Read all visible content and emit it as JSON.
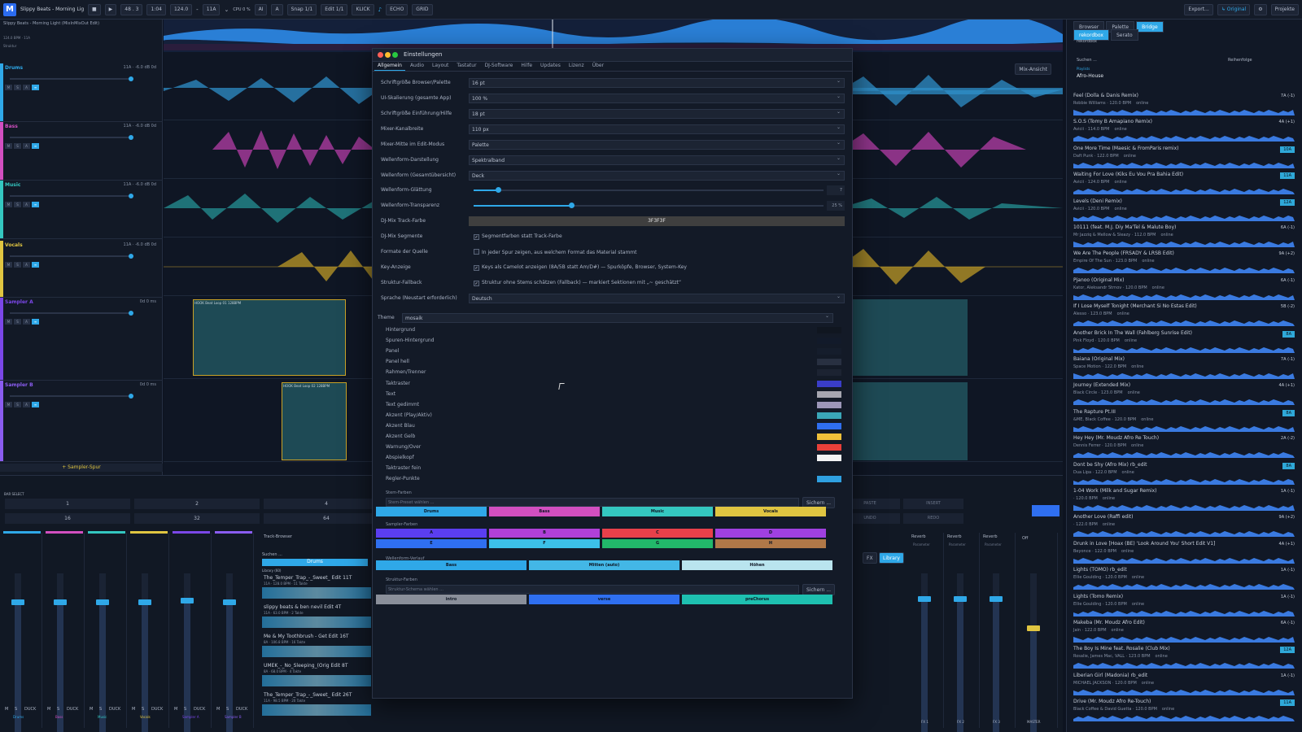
{
  "topbar": {
    "app_initial": "M",
    "title": "Slippy Beats - Morning Light",
    "bars": "48 . 3",
    "time": "1:04",
    "bpm": "124.0",
    "minus": "-",
    "key": "11A",
    "cpu": "CPU 0 %",
    "a_label": "A̲",
    "snap": "Snap 1/1",
    "edit": "Edit 1/1",
    "click": "KLICK",
    "echo": "ECHO",
    "grid": "GRID",
    "export": "Export...",
    "original": "↳ Original",
    "projects": "Projekte"
  },
  "tracks_panel": {
    "project_line": "Slippy Beats - Morning Light (MixInMixOut Edit)",
    "info": "124.0 BPM · 11A",
    "structure": "Struktur",
    "tracks": [
      {
        "name": "Drums",
        "color": "#2fa8e8",
        "meta": "11A  ·  -6.0 dB   0d"
      },
      {
        "name": "Bass",
        "color": "#d24fc0",
        "meta": "11A  ·  -6.0 dB   0d"
      },
      {
        "name": "Music",
        "color": "#34c7c0",
        "meta": "11A  ·  -6.0 dB   0d"
      },
      {
        "name": "Vocals",
        "color": "#e0c541",
        "meta": "11A  ·  -6.0 dB   0d"
      },
      {
        "name": "Sampler A",
        "color": "#7b47e8",
        "meta": "0d   0 ms"
      },
      {
        "name": "Sampler B",
        "color": "#8a5cf0",
        "meta": "0d   0 ms"
      }
    ],
    "add_sampler": "+ Sampler-Spur"
  },
  "arrangement": {
    "mix_view": "Mix-Ansicht",
    "clip_a": "HOOK Beat Loop 01 128BPM",
    "clip_b": "HOOK Beat Loop 02 128BPM"
  },
  "settings": {
    "title": "Einstellungen",
    "tabs": [
      "Allgemein",
      "Audio",
      "Layout",
      "Tastatur",
      "DJ-Software",
      "Hilfe",
      "Updates",
      "Lizenz",
      "Über"
    ],
    "rows": [
      {
        "label": "Schriftgröße Browser/Palette",
        "value": "16 pt"
      },
      {
        "label": "UI-Skalierung (gesamte App)",
        "value": "100 %"
      },
      {
        "label": "Schriftgröße Einführung/Hilfe",
        "value": "18 pt"
      },
      {
        "label": "Mixer-Kanalbreite",
        "value": "110 px"
      },
      {
        "label": "Mixer-Mitte im Edit-Modus",
        "value": "Palette"
      },
      {
        "label": "Wellenform-Darstellung",
        "value": "Spektralband"
      },
      {
        "label": "Wellenform (Gesamtübersicht)",
        "value": "Deck"
      }
    ],
    "smoothing_label": "Wellenform-Glättung",
    "smoothing_value": "7",
    "smoothing_fraction": 0.07,
    "transparency_label": "Wellenform-Transparenz",
    "transparency_value": "25 %",
    "transparency_fraction": 0.28,
    "track_color_label": "DJ-Mix Track-Farbe",
    "track_color_value": "3F3F3F",
    "segments_label": "DJ-Mix Segmente",
    "segments_text": "Segmentfarben statt Track-Farbe",
    "format_label": "Formate der Quelle",
    "format_text": "In jeder Spur zeigen, aus welchem Format das Material stammt",
    "key_label": "Key-Anzeige",
    "key_text": "Keys als Camelot anzeigen (8A/5B statt Am/D#) — Spurköpfe, Browser, System-Key",
    "fallback_label": "Struktur-Fallback",
    "fallback_text": "Struktur ohne Stems schätzen (Fallback) — markiert Sektionen mit „~ geschätzt“",
    "language_label": "Sprache (Neustart erforderlich)",
    "language_value": "Deutsch",
    "theme_label": "Theme",
    "theme_value": "mosaik",
    "colors": [
      {
        "label": "Hintergrund",
        "color": "#101620"
      },
      {
        "label": "Spuren-Hintergrund",
        "color": "#121a2a"
      },
      {
        "label": "Panel",
        "color": "#151d2c"
      },
      {
        "label": "Panel hell",
        "color": "#283041"
      },
      {
        "label": "Rahmen/Trenner",
        "color": "#1c2332"
      },
      {
        "label": "Taktraster",
        "color": "#3a3dc8"
      },
      {
        "label": "Text",
        "color": "#a6a6b0"
      },
      {
        "label": "Text gedimmt",
        "color": "#9c97b8"
      },
      {
        "label": "Akzent (Play/Aktiv)",
        "color": "#3aa7b8"
      },
      {
        "label": "Akzent Blau",
        "color": "#2f6ff0"
      },
      {
        "label": "Akzent Gelb",
        "color": "#f0c03a"
      },
      {
        "label": "Warnung/Over",
        "color": "#e8403a"
      },
      {
        "label": "Abspielkopf",
        "color": "#f4f4f4"
      },
      {
        "label": "Taktraster fein",
        "color": "#141a26"
      },
      {
        "label": "Regler-Punkte",
        "color": "#2fa0e0"
      }
    ],
    "stem_colors_label": "Stem-Farben",
    "stem_preset_placeholder": "Stem-Preset wählen ...",
    "save_label": "Sichern ...",
    "stem_buttons": [
      {
        "label": "Drums",
        "color": "#2fa8e8"
      },
      {
        "label": "Bass",
        "color": "#d24fc0"
      },
      {
        "label": "Music",
        "color": "#34c7c0"
      },
      {
        "label": "Vocals",
        "color": "#e0c541"
      }
    ],
    "sampler_colors_label": "Sampler-Farben",
    "sampler_buttons": [
      {
        "label": "A",
        "color": "#5b3ef0"
      },
      {
        "label": "B",
        "color": "#b040d8"
      },
      {
        "label": "C",
        "color": "#e8404a"
      },
      {
        "label": "D",
        "color": "#a040e0"
      },
      {
        "label": "E",
        "color": "#2f6ff0"
      },
      {
        "label": "F",
        "color": "#3cc0e8"
      },
      {
        "label": "G",
        "color": "#22b86a"
      },
      {
        "label": "H",
        "color": "#b07848"
      }
    ],
    "wave_gradient_label": "Wellenform-Verlauf",
    "wave_buttons": [
      {
        "label": "Bass",
        "color": "#2fa8e8"
      },
      {
        "label": "Mitten (auto)",
        "color": "#43b7e6"
      },
      {
        "label": "Höhen",
        "color": "#b9e4ee"
      }
    ],
    "structure_colors_label": "Struktur-Farben",
    "structure_placeholder": "Struktur-Schema wählen ...",
    "structure_buttons": [
      {
        "label": "intro",
        "color": "#8a8f9a"
      },
      {
        "label": "verse",
        "color": "#2f6ff0"
      },
      {
        "label": "preChorus",
        "color": "#1ec0b0"
      }
    ]
  },
  "mixer": {
    "bar_select": "BAR SELECT",
    "bar_buttons": [
      "1",
      "2",
      "4",
      "16",
      "32",
      "64"
    ],
    "right_buttons": [
      "PASTE",
      "INSERT",
      "UNDO",
      "REDO"
    ],
    "track_browser": "Track-Browser",
    "search": "Suchen ...",
    "drums_tab": "Drums",
    "library_header": "Library (60)",
    "library_items": [
      {
        "title": "The_Temper_Trap_-_Sweet_ Edit 11T",
        "meta": "11A · 128.0 BPM · 11 Takte"
      },
      {
        "title": "slippy beats & ben nevil Edit 4T",
        "meta": "11A · 63.0 BPM · 2 Takte"
      },
      {
        "title": "Me & My Toothbrush - Get Edit 16T",
        "meta": "8A · 106.8 BPM · 16 Takte"
      },
      {
        "title": "UMEK_-_No_Sleeping_(Orig Edit 8T",
        "meta": "8A · 68.0 BPM · 4 Takte"
      },
      {
        "title": "The_Temper_Trap_-_Sweet_ Edit 26T",
        "meta": "11A · 98.5 BPM · 20 Takte"
      }
    ],
    "fx_label": "FX",
    "library_button": "Library",
    "reverbs": [
      "Reverb",
      "Reverb",
      "Reverb"
    ],
    "param": "Parameter",
    "off": "Off",
    "strip_labels": [
      "Drums",
      "Bass",
      "Music",
      "Vocals",
      "Sampler A",
      "Sampler B"
    ],
    "strip_colors": [
      "#2fa8e8",
      "#d24fc0",
      "#34c7c0",
      "#e0c541",
      "#7b47e8",
      "#8a5cf0"
    ],
    "strip_levels": [
      0.82,
      0.82,
      0.82,
      0.82,
      0.83,
      0.82
    ],
    "fx_names": [
      "FX 1",
      "FX 2",
      "FX 3"
    ],
    "fx_levels": [
      0.84,
      0.84,
      0.84
    ],
    "master": "MASTER",
    "master_level": 0.66,
    "duck": "DUCK",
    "m": "M",
    "s": "S"
  },
  "browser": {
    "tabs": [
      "Browser",
      "Palette",
      "Bridge"
    ],
    "subtabs": [
      "rekordbox",
      "Serato"
    ],
    "source": "rekordbox",
    "search": "Suchen ...",
    "sort": "Reihenfolge",
    "playlist_label": "Playlists",
    "playlist": "Afro-House",
    "songs": [
      {
        "title": "Feel (Dolla & Danis Remix)",
        "meta": "Robbie Williams · 120.0 BPM",
        "key": "7A (-1)",
        "hl": false
      },
      {
        "title": "S.O.S (Tomy B Amapiano Remix)",
        "meta": "Avicii · 114.0 BPM",
        "key": "4A (+1)",
        "hl": false
      },
      {
        "title": "One More Time (Maesic & FromParis remix)",
        "meta": "Daft Punk · 122.0 BPM",
        "key": "10A",
        "hl": true
      },
      {
        "title": "Waiting For Love (Kiks Eu Vou Pra Bahia Edit)",
        "meta": "Avicii · 124.0 BPM",
        "key": "11A",
        "hl": true
      },
      {
        "title": "Levels (Deni Remix)",
        "meta": "Avicii · 120.0 BPM",
        "key": "12A",
        "hl": true
      },
      {
        "title": "10111 (feat. M.J. Diy Ma'Tel & Malute Boy)",
        "meta": "Mr Jazziq & Mellow & Sleazy · 112.0 BPM",
        "key": "6A (-1)",
        "hl": false
      },
      {
        "title": "We Are The People (FRSADY & LRSB Edit)",
        "meta": "Empire Of The Sun · 123.0 BPM",
        "key": "9A (+2)",
        "hl": false
      },
      {
        "title": "Pjanoo (Original Mix)",
        "meta": "Kator, Aleksandr Strnov · 120.0 BPM",
        "key": "6A (-1)",
        "hl": false
      },
      {
        "title": "If I Lose Myself Tonight (Merchant Si No Estas Edit)",
        "meta": "Alesso · 123.0 BPM",
        "key": "5B (-2)",
        "hl": false
      },
      {
        "title": "Another Brick In The Wall (Fahlberg Sunrise Edit)",
        "meta": "Pink Floyd · 120.0 BPM",
        "key": "8A",
        "hl": true
      },
      {
        "title": "Baiana (Original Mix)",
        "meta": "Space Motion · 122.0 BPM",
        "key": "7A (-1)",
        "hl": false
      },
      {
        "title": "Journey (Extended Mix)",
        "meta": "Black Circle · 123.0 BPM",
        "key": "4A (+1)",
        "hl": false
      },
      {
        "title": "The Rapture Pt.III",
        "meta": "&ME, Black Coffee · 120.0 BPM",
        "key": "8A",
        "hl": true
      },
      {
        "title": "Hey Hey (Mr. Moudz Afro Re Touch)",
        "meta": "Dennis Ferrer · 120.0 BPM",
        "key": "2A (-2)",
        "hl": false
      },
      {
        "title": "Dont be Shy (Afro Mix) rb_edit",
        "meta": "Dua Lipa · 122.0 BPM",
        "key": "8A",
        "hl": true
      },
      {
        "title": "1-04 Work (Milk and Sugar Remix)",
        "meta": "· 120.0 BPM",
        "key": "1A (-1)",
        "hl": false
      },
      {
        "title": "Another Love (Raffi edit)",
        "meta": "· 122.0 BPM",
        "key": "9A (+2)",
        "hl": false
      },
      {
        "title": "Drunk in Love [Hoax (BE) 'Look Around You' Short Edit V1]",
        "meta": "Beyonce · 122.0 BPM",
        "key": "4A (+1)",
        "hl": false
      },
      {
        "title": "Lights (TOMO) rb_edit",
        "meta": "Ellie Goulding · 120.0 BPM",
        "key": "1A (-1)",
        "hl": false
      },
      {
        "title": "Lights (Tomo Remix)",
        "meta": "Ellie Goulding · 120.0 BPM",
        "key": "1A (-1)",
        "hl": false
      },
      {
        "title": "Makeba (Mr. Moudz Afro Edit)",
        "meta": "Jain · 122.0 BPM",
        "key": "6A (-1)",
        "hl": false
      },
      {
        "title": "The Boy Is Mine feat. Rosalie (Club Mix)",
        "meta": "Rosalie, James Mac, VALL · 123.0 BPM",
        "key": "12A",
        "hl": true
      },
      {
        "title": "Liberian Girl (Madonia) rb_edit",
        "meta": "MICHAEL JACKSON · 120.0 BPM",
        "key": "1A (-1)",
        "hl": false
      },
      {
        "title": "Drive (Mr. Moudz Afro Re-Touch)",
        "meta": "Black Coffee & David Guetta · 120.0 BPM",
        "key": "11A",
        "hl": true
      }
    ],
    "online": "online"
  }
}
